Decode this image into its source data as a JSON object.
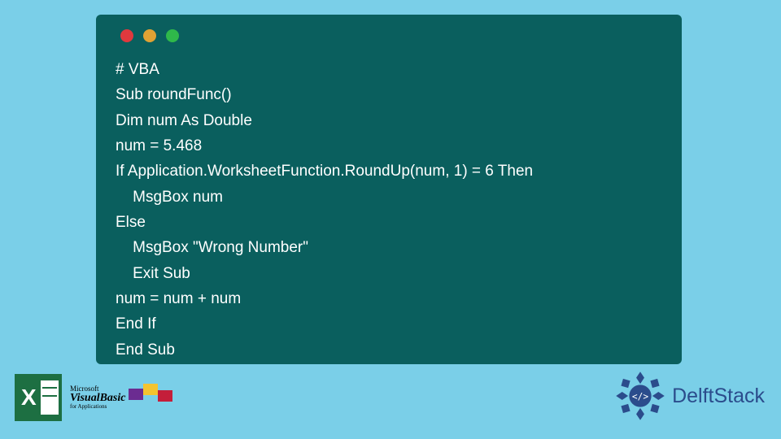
{
  "code": {
    "l1": "# VBA",
    "l2": "Sub roundFunc()",
    "l3": "Dim num As Double",
    "l4": "num = 5.468",
    "l5": "If Application.WorksheetFunction.RoundUp(num, 1) = 6 Then",
    "l6": "    MsgBox num",
    "l7": "Else",
    "l8": "    MsgBox \"Wrong Number\"",
    "l9": "    Exit Sub",
    "l10": "num = num + num",
    "l11": "End If",
    "l12": "End Sub"
  },
  "logos": {
    "vb_ms": "Microsoft",
    "vb_main": "VisualBasic",
    "vb_sub": "for Applications",
    "delft": "DelftStack"
  },
  "colors": {
    "page_bg": "#7ACFE8",
    "code_bg": "#0A5F5E",
    "code_fg": "#FFFFFF",
    "excel": "#1D6F42",
    "delft_blue": "#2B4C8C"
  }
}
